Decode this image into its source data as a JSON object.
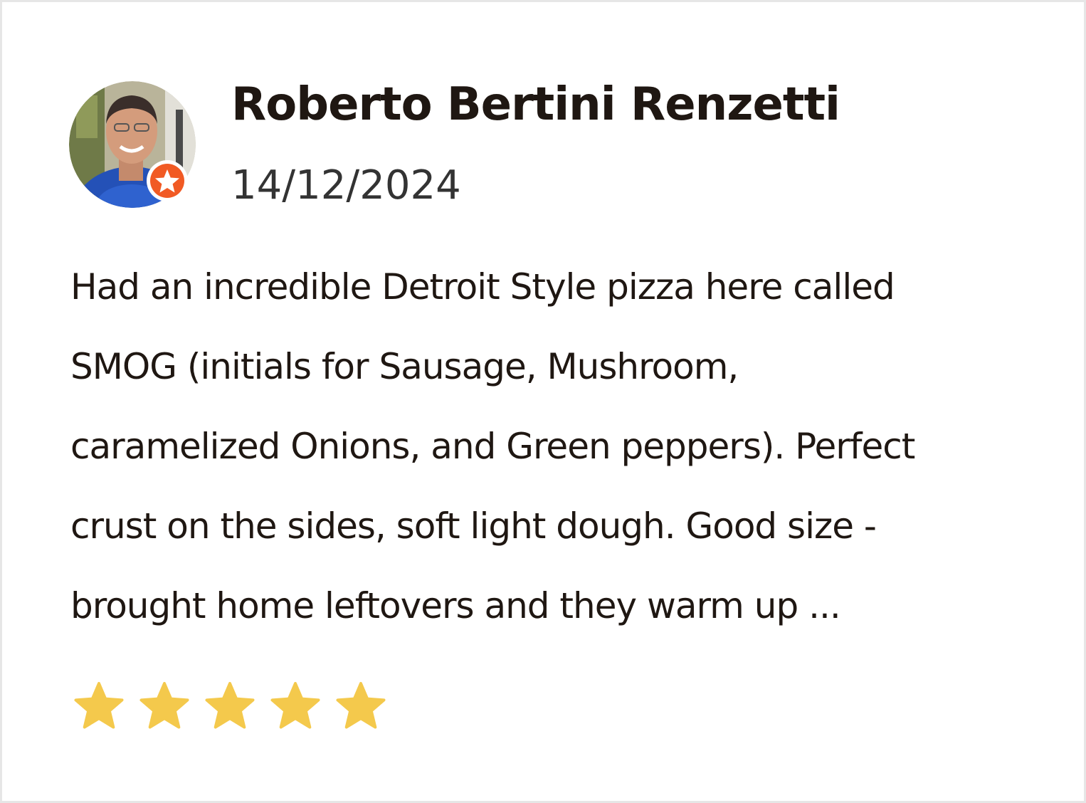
{
  "review": {
    "reviewer_name": "Roberto Bertini Renzetti",
    "date": "14/12/2024",
    "text_lines": [
      "Had an incredible Detroit Style pizza here called",
      "SMOG (initials for Sausage, Mushroom,",
      "caramelized Onions, and Green peppers). Perfect",
      "crust on the sides, soft light dough. Good size -",
      "brought home leftovers and they warm up ..."
    ],
    "rating": 5,
    "max_rating": 5
  },
  "colors": {
    "star": "#f4c94c",
    "badge": "#f15a24",
    "name_text": "#1f1712",
    "date_text": "#333333",
    "card_border": "#e6e6e6"
  },
  "icons": {
    "avatar": "user-photo",
    "badge": "elite-star-badge-icon",
    "rating_star": "star-icon"
  }
}
